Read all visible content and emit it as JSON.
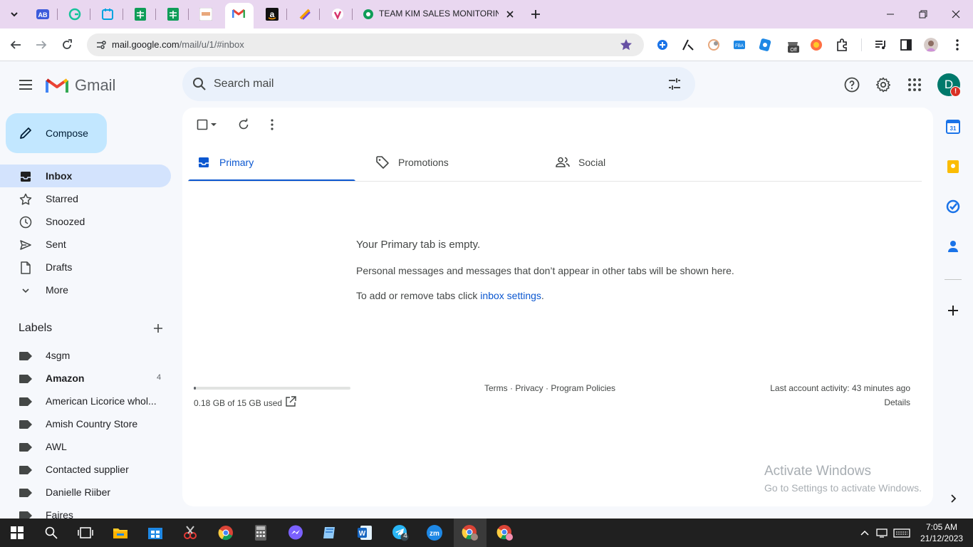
{
  "browser": {
    "tabs": [
      {
        "icon": "ab-icon",
        "active": false
      },
      {
        "icon": "grammarly-icon",
        "active": false
      },
      {
        "icon": "calendar-extension-icon",
        "active": false
      },
      {
        "icon": "google-sheets-icon",
        "active": false
      },
      {
        "icon": "google-sheets-icon",
        "active": false
      },
      {
        "icon": "site-favicon-icon",
        "active": false
      },
      {
        "icon": "gmail-icon",
        "active": true
      },
      {
        "icon": "amazon-icon",
        "active": false
      },
      {
        "icon": "app-icon",
        "active": false
      },
      {
        "icon": "app-icon",
        "active": false
      },
      {
        "icon": "sheets-app-icon",
        "title": "TEAM KIM SALES MONITORING",
        "active": false
      }
    ],
    "named_tab_title": "TEAM KIM SALES MONITORING",
    "url": {
      "host": "mail.google.com",
      "path": "/mail/u/1/#inbox"
    }
  },
  "gmail": {
    "brand": "Gmail",
    "search": {
      "placeholder": "Search mail"
    },
    "avatar": {
      "initial": "D",
      "badge": "!"
    },
    "compose_label": "Compose",
    "nav": [
      {
        "label": "Inbox",
        "icon": "inbox-icon",
        "active": true
      },
      {
        "label": "Starred",
        "icon": "star-icon",
        "active": false
      },
      {
        "label": "Snoozed",
        "icon": "clock-icon",
        "active": false
      },
      {
        "label": "Sent",
        "icon": "send-icon",
        "active": false
      },
      {
        "label": "Drafts",
        "icon": "draft-icon",
        "active": false
      },
      {
        "label": "More",
        "icon": "chevron-down-icon",
        "active": false
      }
    ],
    "labels_heading": "Labels",
    "labels": [
      {
        "name": "4sgm",
        "bold": false,
        "count": ""
      },
      {
        "name": "Amazon",
        "bold": true,
        "count": "4"
      },
      {
        "name": "American Licorice whol...",
        "bold": false,
        "count": ""
      },
      {
        "name": "Amish Country Store",
        "bold": false,
        "count": ""
      },
      {
        "name": "AWL",
        "bold": false,
        "count": ""
      },
      {
        "name": "Contacted supplier",
        "bold": false,
        "count": ""
      },
      {
        "name": "Danielle Riiber",
        "bold": false,
        "count": ""
      },
      {
        "name": "Faires",
        "bold": false,
        "count": ""
      }
    ],
    "tabs": [
      {
        "label": "Primary",
        "icon": "inbox-tab-icon",
        "active": true
      },
      {
        "label": "Promotions",
        "icon": "tag-icon",
        "active": false
      },
      {
        "label": "Social",
        "icon": "people-icon",
        "active": false
      }
    ],
    "empty": {
      "title": "Your Primary tab is empty.",
      "description": "Personal messages and messages that don’t appear in other tabs will be shown here.",
      "settings_prefix": "To add or remove tabs click ",
      "settings_link": "inbox settings",
      "settings_suffix": "."
    },
    "storage": {
      "text": "0.18 GB of 15 GB used",
      "fraction": 0.012
    },
    "footer_links": "Terms · Privacy · Program Policies",
    "last_activity": "Last account activity: 43 minutes ago",
    "details": "Details"
  },
  "watermark": {
    "line1": "Activate Windows",
    "line2": "Go to Settings to activate Windows."
  },
  "taskbar": {
    "time": "7:05 AM",
    "date": "21/12/2023",
    "telegram_badge": "4"
  },
  "colors": {
    "tabstrip": "#e9d7f0",
    "compose": "#c2e7ff",
    "active_nav": "#d3e3fd",
    "accent": "#0b57d0",
    "avatar": "#00796b"
  }
}
